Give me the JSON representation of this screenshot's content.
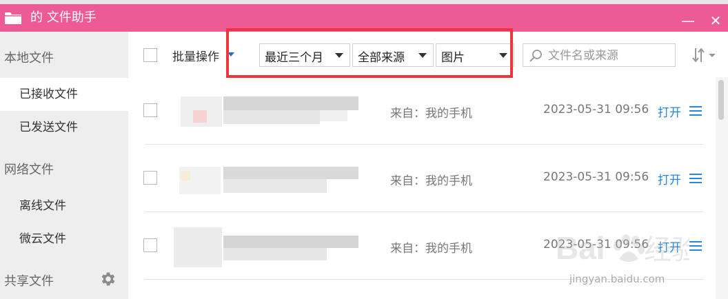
{
  "window": {
    "title": "的 文件助手",
    "minimize_label": "—",
    "close_label": "✕",
    "accent_color": "#ec5b96"
  },
  "sidebar": {
    "sections": [
      {
        "label": "本地文件"
      },
      {
        "label": "网络文件"
      },
      {
        "label": "共享文件"
      }
    ],
    "items": [
      {
        "label": "已接收文件",
        "active": true
      },
      {
        "label": "已发送文件",
        "active": false
      },
      {
        "label": "离线文件",
        "active": false
      },
      {
        "label": "微云文件",
        "active": false
      }
    ],
    "settings_icon": "gear-icon"
  },
  "toolbar": {
    "batch_label": "批量操作",
    "filters": [
      {
        "value": "最近三个月"
      },
      {
        "value": "全部来源"
      },
      {
        "value": "图片"
      }
    ],
    "search_placeholder": "文件名或来源",
    "highlight_color": "#f0343d"
  },
  "files": [
    {
      "source": "来自：我的手机",
      "date": "2023-05-31 09:56",
      "open_label": "打开"
    },
    {
      "source": "来自：我的手机",
      "date": "2023-05-31 09:56",
      "open_label": "打开"
    },
    {
      "source": "来自：我的手机",
      "date": "2023-05-31 09:56",
      "open_label": "打开"
    }
  ],
  "watermark": {
    "url": "jingyan.baidu.com"
  }
}
